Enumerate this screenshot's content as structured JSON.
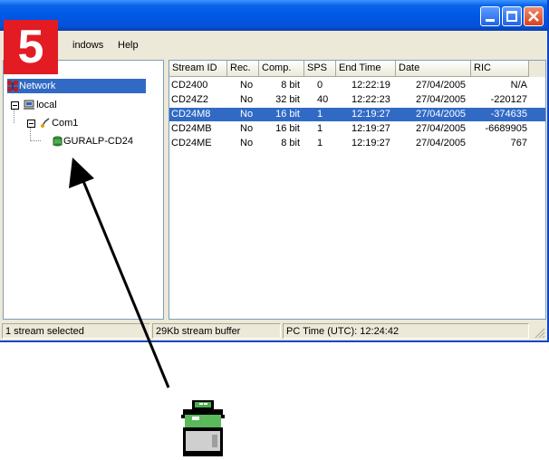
{
  "step_number": "5",
  "menu": {
    "windows": "Windows",
    "windows_visible": "indows",
    "help": "Help"
  },
  "tree": {
    "network": "Network",
    "local": "local",
    "com1": "Com1",
    "device": "GURALP-CD24"
  },
  "columns": [
    "Stream ID",
    "Rec.",
    "Comp.",
    "SPS",
    "End Time",
    "Date",
    "RIC"
  ],
  "rows": [
    {
      "stream_id": "CD2400",
      "rec": "No",
      "comp": "8 bit",
      "sps": "0",
      "end_time": "12:22:19",
      "date": "27/04/2005",
      "ric": "N/A",
      "selected": false
    },
    {
      "stream_id": "CD24Z2",
      "rec": "No",
      "comp": "32 bit",
      "sps": "40",
      "end_time": "12:22:23",
      "date": "27/04/2005",
      "ric": "-220127",
      "selected": false
    },
    {
      "stream_id": "CD24M8",
      "rec": "No",
      "comp": "16 bit",
      "sps": "1",
      "end_time": "12:19:27",
      "date": "27/04/2005",
      "ric": "-374635",
      "selected": true
    },
    {
      "stream_id": "CD24MB",
      "rec": "No",
      "comp": "16 bit",
      "sps": "1",
      "end_time": "12:19:27",
      "date": "27/04/2005",
      "ric": "-6689905",
      "selected": false
    },
    {
      "stream_id": "CD24ME",
      "rec": "No",
      "comp": "8 bit",
      "sps": "1",
      "end_time": "12:19:27",
      "date": "27/04/2005",
      "ric": "767",
      "selected": false
    }
  ],
  "status": {
    "selection": "1 stream selected",
    "buffer": "29Kb stream buffer",
    "pc_time": "PC Time (UTC):  12:24:42"
  },
  "colors": {
    "title_blue": "#0058e6",
    "selection_blue": "#316ac5",
    "badge_red": "#e31b23",
    "device_green": "#4caf50"
  }
}
